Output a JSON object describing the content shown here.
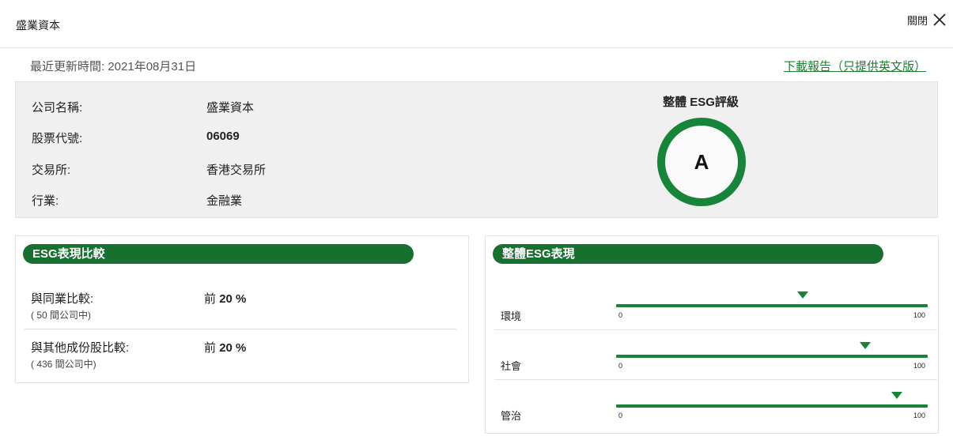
{
  "header": {
    "title": "盛業資本",
    "close_label": "關閉"
  },
  "updated": "最近更新時間: 2021年08月31日",
  "download_link": "下載報告（只提供英文版）",
  "info": {
    "company_label": "公司名稱:",
    "company_value": "盛業資本",
    "code_label": "股票代號:",
    "code_value": "06069",
    "exchange_label": "交易所:",
    "exchange_value": "香港交易所",
    "industry_label": "行業:",
    "industry_value": "金融業"
  },
  "rating": {
    "title": "整體 ESG評級",
    "grade": "A"
  },
  "comparison": {
    "heading": "ESG表現比較",
    "rows": [
      {
        "label": "與同業比較:",
        "sub": "( 50 間公司中)",
        "value_prefix": "前",
        "value": "20 %"
      },
      {
        "label": "與其他成份股比較:",
        "sub": "( 436 間公司中)",
        "value_prefix": "前",
        "value": "20 %"
      }
    ]
  },
  "performance": {
    "heading": "整體ESG表現",
    "scale_min": "0",
    "scale_max": "100",
    "items": [
      {
        "label": "環境",
        "score": 60
      },
      {
        "label": "社會",
        "score": 80
      },
      {
        "label": "管治",
        "score": 90
      }
    ]
  },
  "colors": {
    "accent": "#17843a",
    "pill": "#17702f",
    "panel_bg": "#f0f0f0",
    "link": "#1e7e34"
  },
  "icons": {
    "close": "close-icon"
  }
}
